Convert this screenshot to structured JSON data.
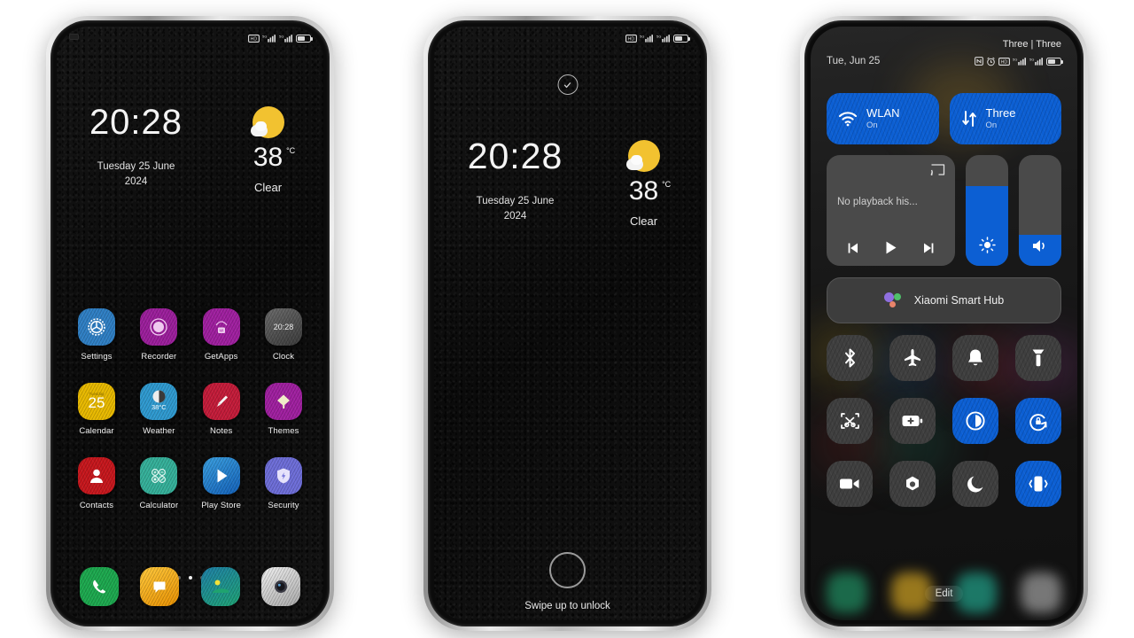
{
  "screens": {
    "home": {
      "name": "home-screen",
      "statusbar": {
        "icons": [
          "hd-icon",
          "signal-5g-icon",
          "signal-5g-icon",
          "battery-icon"
        ],
        "battery_level": "55"
      },
      "clock": {
        "time": "20:28",
        "date_line1": "Tuesday 25 June",
        "date_line2": "2024"
      },
      "weather": {
        "icon": "sun-cloud-icon",
        "temperature": "38",
        "unit": "°C",
        "condition": "Clear"
      },
      "apps_row1": [
        {
          "label": "Settings",
          "icon": "settings-gear-icon",
          "color": "#2f7fc4"
        },
        {
          "label": "Recorder",
          "icon": "recorder-icon",
          "color": "#9c1f9c"
        },
        {
          "label": "GetApps",
          "icon": "getapps-bag-icon",
          "color": "#a020a0"
        },
        {
          "label": "Clock",
          "icon": "clock-icon",
          "color": "#4a4a4a",
          "badge": "20:28"
        }
      ],
      "apps_row2": [
        {
          "label": "Calendar",
          "icon": "calendar-icon",
          "color": "#e8b900",
          "badge": "25",
          "badge_top": "Tuesday"
        },
        {
          "label": "Weather",
          "icon": "weather-moon-icon",
          "color": "#2f9ad0",
          "badge": "38°C"
        },
        {
          "label": "Notes",
          "icon": "notes-pencil-icon",
          "color": "#c41c3a"
        },
        {
          "label": "Themes",
          "icon": "themes-brush-icon",
          "color": "#a020a0"
        }
      ],
      "apps_row3": [
        {
          "label": "Contacts",
          "icon": "contacts-person-icon",
          "color": "#c7171d"
        },
        {
          "label": "Calculator",
          "icon": "calculator-icon",
          "color": "#35b09a"
        },
        {
          "label": "Play Store",
          "icon": "play-store-icon",
          "color": "#1b7fd0"
        },
        {
          "label": "Security",
          "icon": "security-shield-icon",
          "color": "#6e6ed8"
        }
      ],
      "dock": [
        {
          "label": "Phone",
          "icon": "phone-icon",
          "color": "#1da94f"
        },
        {
          "label": "Messages",
          "icon": "messages-icon",
          "color": "#f0a500"
        },
        {
          "label": "Browser",
          "icon": "browser-icon",
          "color": "#1e9c7a"
        },
        {
          "label": "Camera",
          "icon": "camera-icon",
          "color": "#cfcfcf"
        }
      ],
      "page_indicator": {
        "total": 3,
        "active": 2
      }
    },
    "lock": {
      "name": "lock-screen",
      "notification_icon": "check-circle-icon",
      "statusbar": {
        "icons": [
          "hd-icon",
          "signal-5g-icon",
          "signal-5g-icon",
          "battery-icon"
        ]
      },
      "clock": {
        "time": "20:28",
        "date_line1": "Tuesday 25 June",
        "date_line2": "2024"
      },
      "weather": {
        "icon": "sun-cloud-icon",
        "temperature": "38",
        "unit": "°C",
        "condition": "Clear"
      },
      "unlock_hint": "Swipe up to unlock",
      "fingerprint_icon": "fingerprint-ring-icon"
    },
    "control_center": {
      "name": "control-center",
      "carrier": "Three | Three",
      "date": "Tue, Jun 25",
      "statusbar": {
        "icons": [
          "nfc-icon",
          "alarm-icon",
          "hd-icon",
          "signal-5g-icon",
          "signal-5g-icon",
          "battery-icon"
        ]
      },
      "big_tiles": [
        {
          "label": "WLAN",
          "state": "On",
          "icon": "wifi-icon",
          "active": true
        },
        {
          "label": "Three",
          "state": "On",
          "icon": "mobile-data-icon",
          "active": true
        }
      ],
      "media": {
        "title": "No playback his...",
        "cast_icon": "cast-icon",
        "controls": [
          "previous-icon",
          "play-icon",
          "next-icon"
        ]
      },
      "brightness": {
        "icon": "brightness-icon",
        "level": 72
      },
      "volume": {
        "icon": "volume-icon",
        "level": 28
      },
      "smart_hub": {
        "label": "Xiaomi Smart Hub",
        "icon": "assistant-dots-icon"
      },
      "toggles_row1": [
        {
          "icon": "bluetooth-icon",
          "name": "bluetooth",
          "active": false
        },
        {
          "icon": "airplane-icon",
          "name": "airplane-mode",
          "active": false
        },
        {
          "icon": "bell-icon",
          "name": "ringtone",
          "active": false
        },
        {
          "icon": "flashlight-icon",
          "name": "flashlight",
          "active": false
        }
      ],
      "toggles_row2": [
        {
          "icon": "screenshot-icon",
          "name": "screenshot",
          "active": false
        },
        {
          "icon": "battery-saver-icon",
          "name": "battery-saver",
          "active": false
        },
        {
          "icon": "dark-mode-icon",
          "name": "dark-mode",
          "active": true
        },
        {
          "icon": "rotation-lock-icon",
          "name": "rotation-lock",
          "active": true
        }
      ],
      "toggles_row3": [
        {
          "icon": "screen-record-icon",
          "name": "screen-recorder",
          "active": false
        },
        {
          "icon": "camera-shutter-icon",
          "name": "camera",
          "active": false
        },
        {
          "icon": "moon-icon",
          "name": "do-not-disturb",
          "active": false
        },
        {
          "icon": "vibrate-icon",
          "name": "vibrate",
          "active": true
        }
      ],
      "edit_label": "Edit",
      "dock_blurred": [
        "#1e7a55",
        "#b08a20",
        "#1e8a76",
        "#8a8a8a"
      ]
    }
  },
  "colors": {
    "accent_blue": "#0c5fd3",
    "tile_gray": "#4a4a4a",
    "sun_yellow": "#f2c230"
  }
}
